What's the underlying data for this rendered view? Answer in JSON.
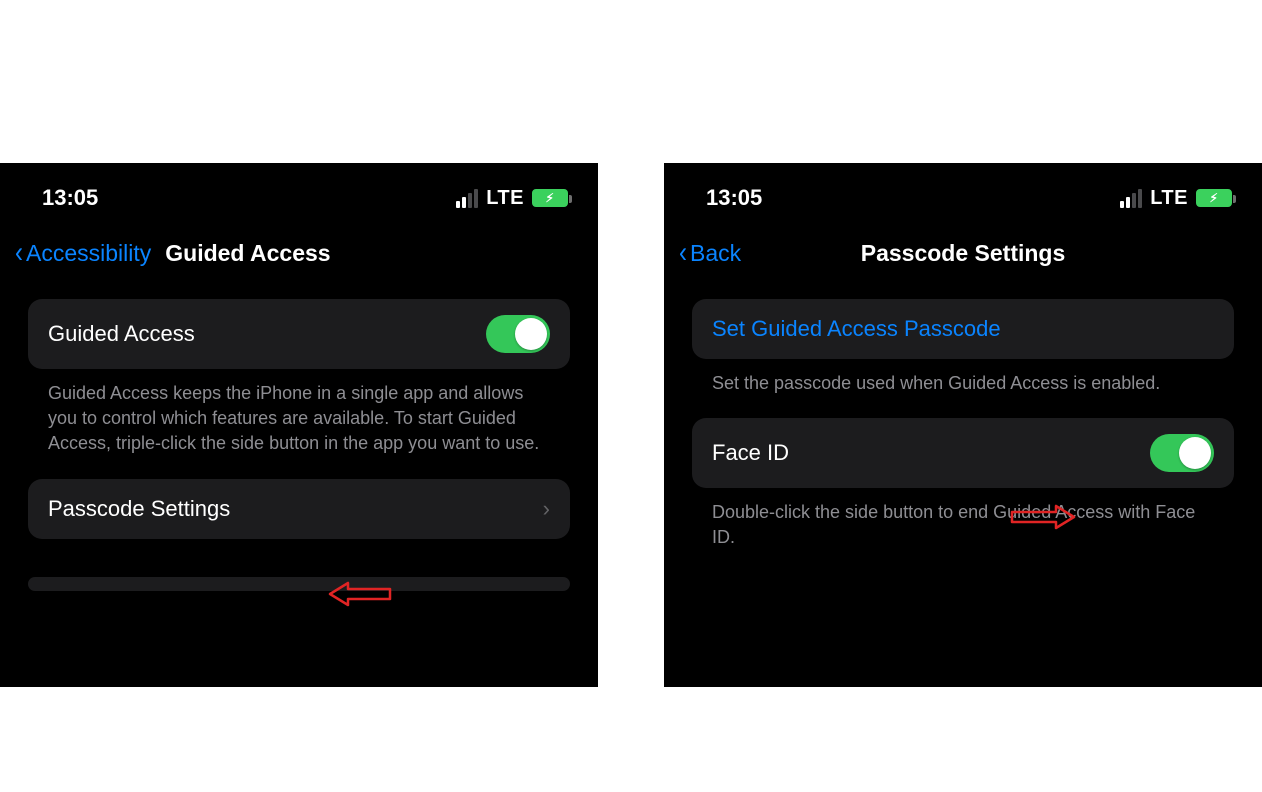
{
  "status": {
    "time": "13:05",
    "network_type": "LTE"
  },
  "left_screen": {
    "back_label": "Accessibility",
    "title": "Guided Access",
    "row_guided_access_label": "Guided Access",
    "guided_access_footer": "Guided Access keeps the iPhone in a single app and allows you to control which features are available. To start Guided Access, triple-click the side button in the app you want to use.",
    "row_passcode_settings_label": "Passcode Settings"
  },
  "right_screen": {
    "back_label": "Back",
    "title": "Passcode Settings",
    "row_set_passcode_label": "Set Guided Access Passcode",
    "set_passcode_footer": "Set the passcode used when Guided Access is enabled.",
    "row_face_id_label": "Face ID",
    "face_id_footer": "Double-click the side button to end Guided Access with Face ID."
  }
}
